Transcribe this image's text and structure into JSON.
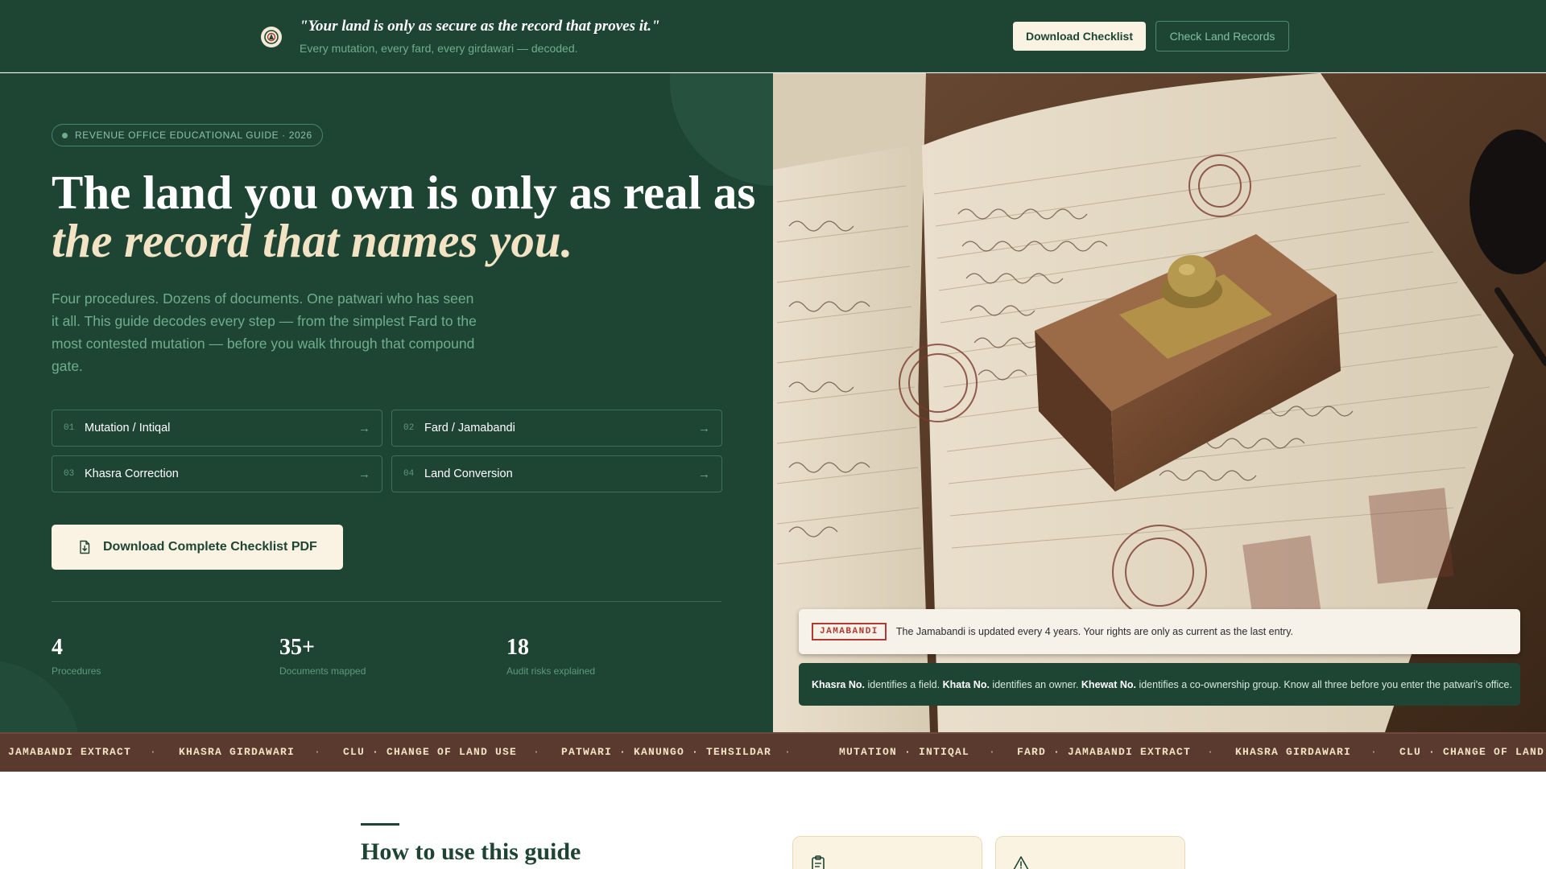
{
  "header": {
    "quote": "\"Your land is only as secure as the record that proves it.\"",
    "subtitle": "Every mutation, every fard, every girdawari — decoded.",
    "download_btn": "Download Checklist",
    "check_btn": "Check Land Records"
  },
  "hero": {
    "badge": "REVENUE OFFICE EDUCATIONAL GUIDE · 2026",
    "title_plain": "The land you own is only as real as ",
    "title_emphasis": "the record that names you.",
    "description": "Four procedures. Dozens of documents. One patwari who has seen it all. This guide decodes every step — from the simplest Fard to the most contested mutation — before you walk through that compound gate.",
    "procedures": [
      {
        "num": "01",
        "label": "Mutation / Intiqal"
      },
      {
        "num": "02",
        "label": "Fard / Jamabandi"
      },
      {
        "num": "03",
        "label": "Khasra Correction"
      },
      {
        "num": "04",
        "label": "Land Conversion"
      }
    ],
    "pdf_btn": "Download Complete Checklist PDF",
    "stats": [
      {
        "value": "4",
        "label": "Procedures"
      },
      {
        "value": "35+",
        "label": "Documents mapped"
      },
      {
        "value": "18",
        "label": "Audit risks explained"
      }
    ]
  },
  "image_notes": {
    "stamp_label": "JAMABANDI",
    "light_note": "The Jamabandi is updated every 4 years. Your rights are only as current as the last entry.",
    "dark_note": {
      "t1": "Khasra No.",
      "t2": " identifies a field. ",
      "t3": "Khata No.",
      "t4": " identifies an owner. ",
      "t5": "Khewat No.",
      "t6": " identifies a co-ownership group. Know all three before you enter the patwari's office."
    }
  },
  "ticker": {
    "items": [
      "JAMABANDI EXTRACT",
      "KHASRA GIRDAWARI",
      "CLU · CHANGE OF LAND USE",
      "PATWARI · KANUNGO · TEHSILDAR",
      "MUTATION · INTIQAL",
      "FARD · JAMABANDI EXTRACT",
      "KHASRA GIRDAWARI",
      "CLU · CHANGE OF LAND U"
    ],
    "separator": "·"
  },
  "section": {
    "title": "How to use this guide"
  },
  "icons": {
    "logo": "seal-logo-icon",
    "pdf": "file-download-icon",
    "card1": "clipboard-icon",
    "card2": "warning-icon",
    "arrow": "arrow-right-icon"
  },
  "colors": {
    "forest": "#1e4534",
    "cream": "#faf3e3",
    "mint": "#6fae8c",
    "ticker_brown": "#5a3a2e",
    "stamp_red": "#b03a30"
  }
}
